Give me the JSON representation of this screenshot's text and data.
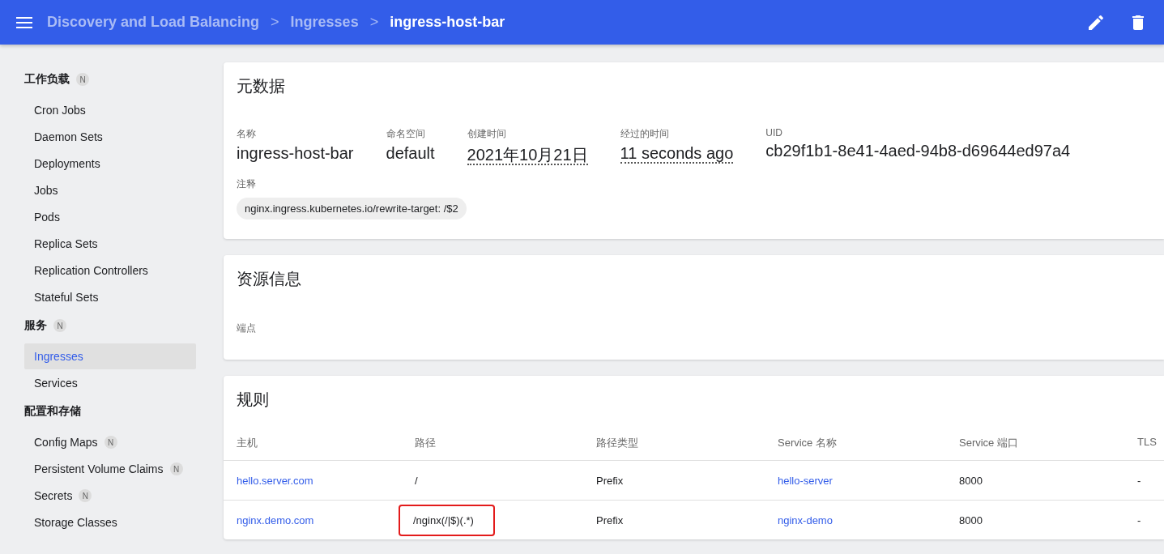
{
  "toolbar": {
    "breadcrumbs": [
      {
        "label": "Discovery and Load Balancing",
        "current": false
      },
      {
        "label": "Ingresses",
        "current": false
      },
      {
        "label": "ingress-host-bar",
        "current": true
      }
    ],
    "separator": ">"
  },
  "sidebar": {
    "sections": [
      {
        "title": "工作负载",
        "badge": "N",
        "items": [
          {
            "label": "Cron Jobs",
            "selected": false
          },
          {
            "label": "Daemon Sets",
            "selected": false
          },
          {
            "label": "Deployments",
            "selected": false
          },
          {
            "label": "Jobs",
            "selected": false
          },
          {
            "label": "Pods",
            "selected": false
          },
          {
            "label": "Replica Sets",
            "selected": false
          },
          {
            "label": "Replication Controllers",
            "selected": false
          },
          {
            "label": "Stateful Sets",
            "selected": false
          }
        ]
      },
      {
        "title": "服务",
        "badge": "N",
        "items": [
          {
            "label": "Ingresses",
            "selected": true
          },
          {
            "label": "Services",
            "selected": false
          }
        ]
      },
      {
        "title": "配置和存储",
        "items": [
          {
            "label": "Config Maps",
            "badge": "N",
            "selected": false
          },
          {
            "label": "Persistent Volume Claims",
            "badge": "N",
            "selected": false
          },
          {
            "label": "Secrets",
            "badge": "N",
            "selected": false
          },
          {
            "label": "Storage Classes",
            "selected": false
          }
        ]
      }
    ]
  },
  "metadata": {
    "title": "元数据",
    "fields": [
      {
        "label": "名称",
        "value": "ingress-host-bar",
        "underlined": false
      },
      {
        "label": "命名空间",
        "value": "default",
        "underlined": false
      },
      {
        "label": "创建时间",
        "value": "2021年10月21日",
        "underlined": true
      },
      {
        "label": "经过的时间",
        "value": "11 seconds ago",
        "underlined": true
      },
      {
        "label": "UID",
        "value": "cb29f1b1-8e41-4aed-94b8-d69644ed97a4",
        "underlined": false
      }
    ],
    "annotations_label": "注释",
    "annotations": [
      "nginx.ingress.kubernetes.io/rewrite-target: /$2"
    ]
  },
  "resource_info": {
    "title": "资源信息",
    "endpoints_label": "端点"
  },
  "rules": {
    "title": "规则",
    "columns": [
      "主机",
      "路径",
      "路径类型",
      "Service 名称",
      "Service 端口",
      "TLS"
    ],
    "rows": [
      {
        "host": "hello.server.com",
        "path": "/",
        "path_highlighted": false,
        "path_type": "Prefix",
        "service_name": "hello-server",
        "service_port": "8000",
        "tls": "-"
      },
      {
        "host": "nginx.demo.com",
        "path": "/nginx(/|$)(.*)",
        "path_highlighted": true,
        "path_type": "Prefix",
        "service_name": "nginx-demo",
        "service_port": "8000",
        "tls": "-"
      }
    ]
  }
}
